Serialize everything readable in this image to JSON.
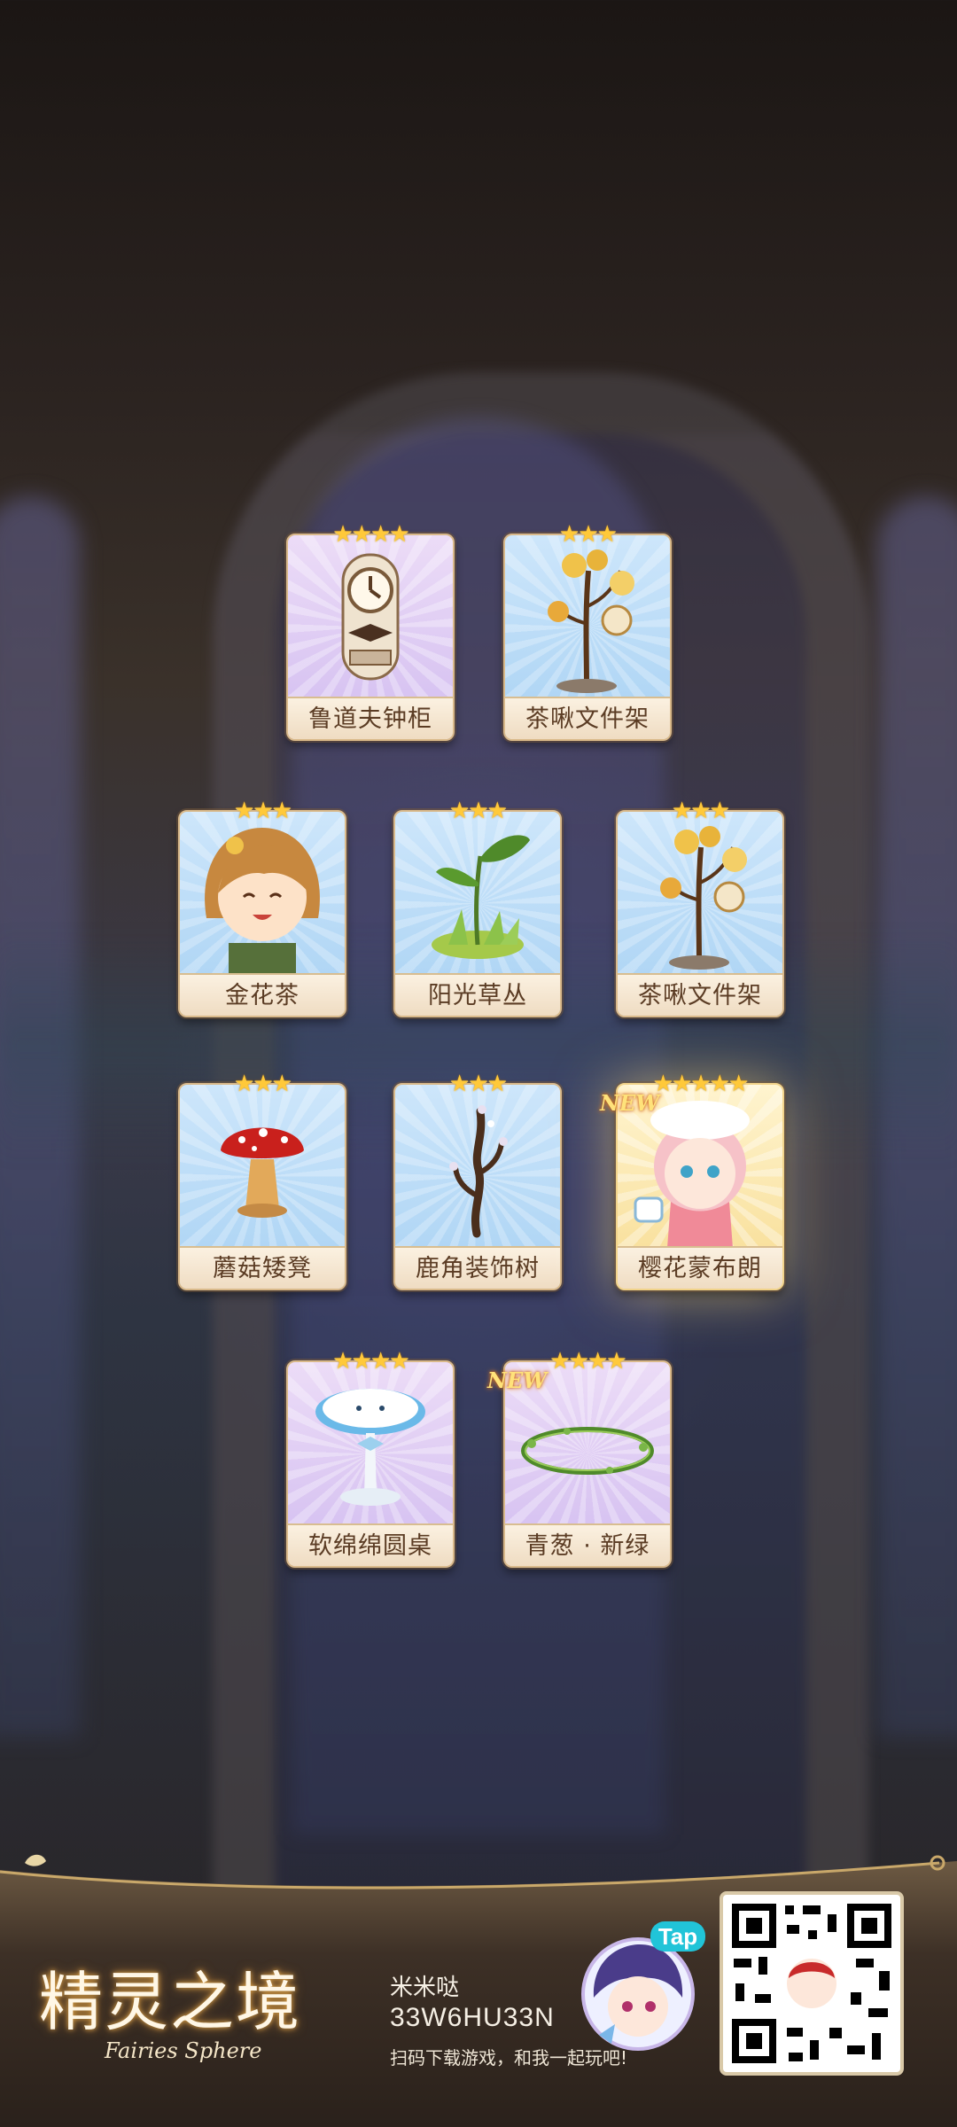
{
  "cards": [
    {
      "name": "鲁道夫钟柜",
      "stars": "★★★★",
      "rarity": 4,
      "new": false
    },
    {
      "name": "茶啾文件架",
      "stars": "★★★",
      "rarity": 3,
      "new": false
    },
    {
      "name": "金花茶",
      "stars": "★★★",
      "rarity": 3,
      "new": false
    },
    {
      "name": "阳光草丛",
      "stars": "★★★",
      "rarity": 3,
      "new": false
    },
    {
      "name": "茶啾文件架",
      "stars": "★★★",
      "rarity": 3,
      "new": false
    },
    {
      "name": "蘑菇矮凳",
      "stars": "★★★",
      "rarity": 3,
      "new": false
    },
    {
      "name": "鹿角装饰树",
      "stars": "★★★",
      "rarity": 3,
      "new": false
    },
    {
      "name": "樱花蒙布朗",
      "stars": "★★★★★",
      "rarity": 5,
      "new": true
    },
    {
      "name": "软绵绵圆桌",
      "stars": "★★★★",
      "rarity": 4,
      "new": false
    },
    {
      "name": "青葱 · 新绿",
      "stars": "★★★★",
      "rarity": 4,
      "new": true
    }
  ],
  "new_label": "NEW",
  "footer": {
    "logo_cn": "精灵之境",
    "logo_en": "Fairies Sphere",
    "player_name": "米米哒",
    "player_code": "33W6HU33N",
    "slogan": "扫码下载游戏，和我一起玩吧!",
    "tap_label": "Tap"
  },
  "colors": {
    "gold": "#ffc93a",
    "label_text": "#5b3c24",
    "tap": "#21c4d8"
  }
}
